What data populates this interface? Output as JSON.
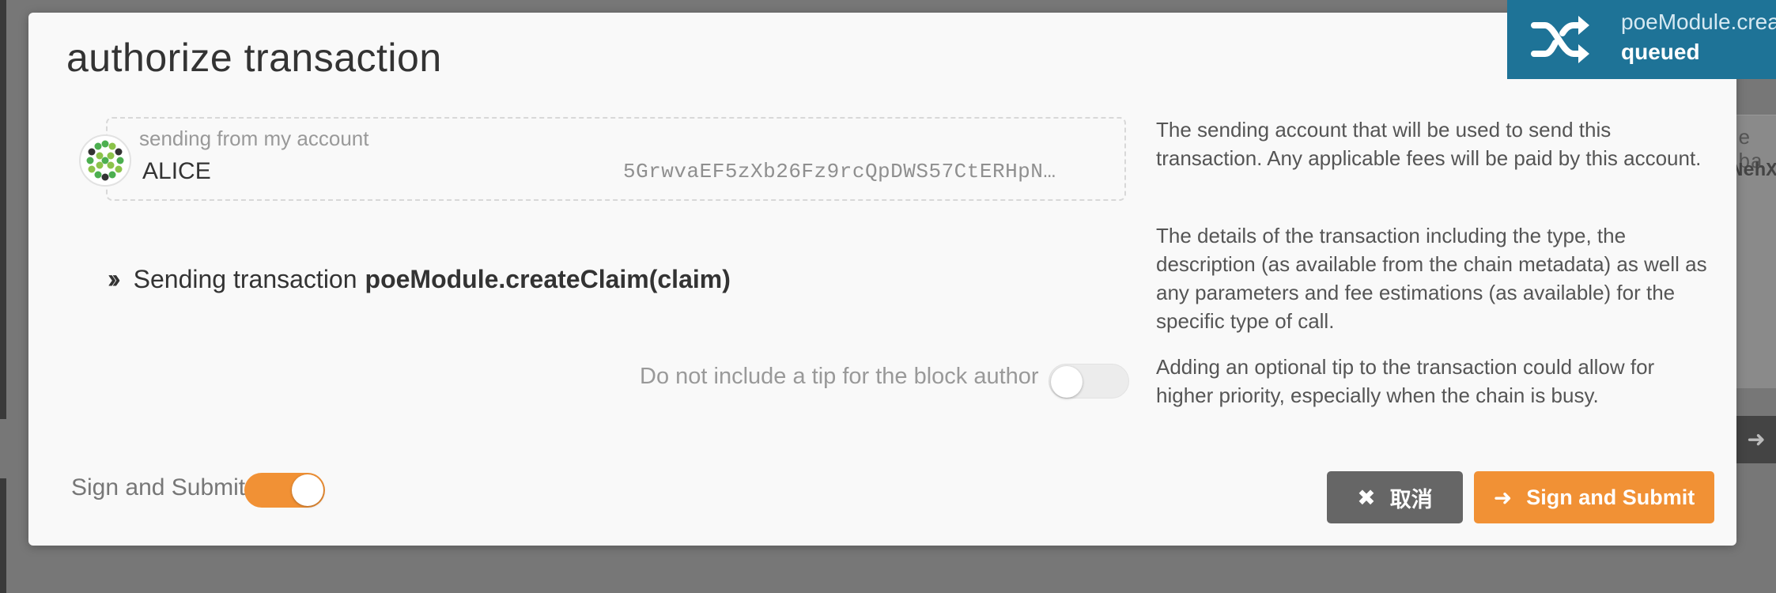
{
  "modal": {
    "title": "authorize transaction",
    "account": {
      "label": "sending from my account",
      "name": "ALICE",
      "address": "5GrwvaEF5zXb26Fz9rcQpDWS57CtERHpN…"
    },
    "transaction": {
      "prefix": "Sending transaction",
      "method": "poeModule.createClaim(claim)"
    },
    "tip": {
      "label": "Do not include a tip for the block author",
      "enabled": false
    },
    "sign": {
      "label": "Sign and Submit",
      "enabled": true
    },
    "help": {
      "account": "The sending account that will be used to send this transaction. Any applicable fees will be paid by this account.",
      "details": "The details of the transaction including the type, the description (as available from the chain metadata) as well as any parameters and fee estimations (as available) for the specific type of call.",
      "tip": "Adding an optional tip to the transaction could allow for higher priority, especially when the chain is busy."
    },
    "buttons": {
      "cancel": "取消",
      "submit": "Sign and Submit"
    }
  },
  "toast": {
    "title": "poeModule.createClaim",
    "status": "queued"
  },
  "background": {
    "fragment1": "e ba",
    "fragment2": "NehX"
  },
  "colors": {
    "accent": "#f19135",
    "cancel": "#666666",
    "toast": "#1e7397"
  }
}
